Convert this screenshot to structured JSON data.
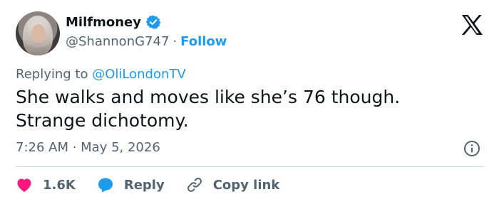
{
  "user": {
    "display_name": "Milfmoney",
    "handle": "@ShannonG747",
    "separator": "·",
    "follow_label": "Follow"
  },
  "reply": {
    "prefix": "Replying to",
    "mention": "@OliLondonTV"
  },
  "tweet": {
    "text_line1": "She walks and moves like she’s 76 though.",
    "text_line2": "Strange dichotomy.",
    "timestamp": "7:26 AM · May 5, 2026"
  },
  "actions": {
    "like_count": "1.6K",
    "reply_label": "Reply",
    "copy_label": "Copy link"
  },
  "colors": {
    "accent": "#1d9bf0",
    "like": "#f91880",
    "muted": "#536471"
  },
  "icons": [
    "verified-badge-icon",
    "x-logo-icon",
    "info-icon",
    "heart-icon",
    "reply-bubble-icon",
    "link-icon"
  ]
}
